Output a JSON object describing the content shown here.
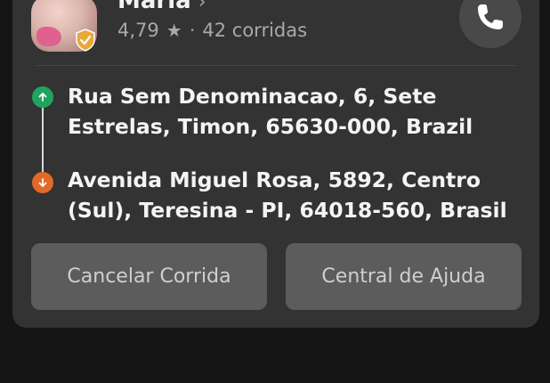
{
  "driver": {
    "name": "Maria",
    "rating": "4,79",
    "rides": "42 corridas"
  },
  "trip": {
    "origin": "Rua Sem Denominacao, 6, Sete Estrelas, Timon, 65630-000, Brazil",
    "destination": "Avenida Miguel Rosa, 5892, Centro (Sul), Teresina - PI, 64018-560, Brasil"
  },
  "actions": {
    "cancel_label": "Cancelar Corrida",
    "help_label": "Central de Ajuda"
  },
  "colors": {
    "origin_marker": "#1fa460",
    "destination_marker": "#e26a27",
    "badge": "#e8a93a"
  },
  "icons": {
    "chevron": "chevron-right-icon",
    "star": "star-icon",
    "call": "phone-icon",
    "origin": "arrow-up-icon",
    "destination": "arrow-down-icon",
    "verified": "verified-badge-icon"
  }
}
